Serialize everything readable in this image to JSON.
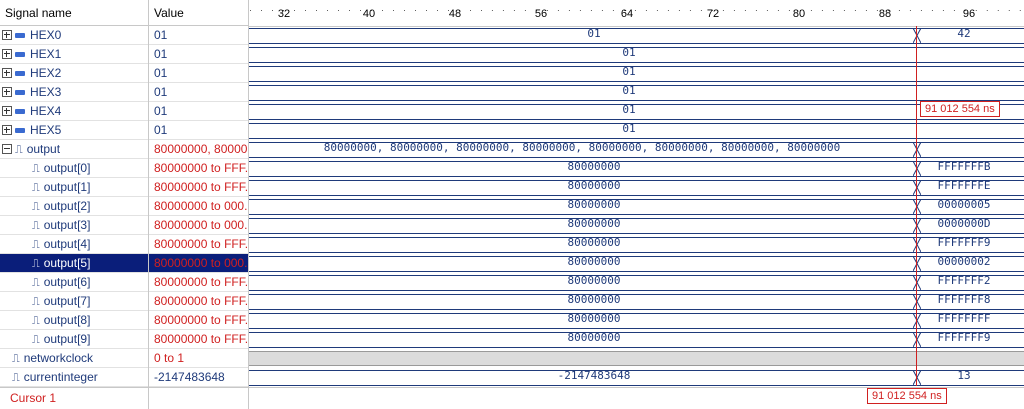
{
  "headers": {
    "signal_name": "Signal name",
    "value": "Value"
  },
  "ruler": {
    "ticks": [
      "32",
      "40",
      "48",
      "56",
      "64",
      "72",
      "80",
      "88",
      "96"
    ]
  },
  "signals": [
    {
      "name": "HEX0",
      "value": "01",
      "type": "bus",
      "expand": "plus",
      "wave_left": "01",
      "wave_right": "42"
    },
    {
      "name": "HEX1",
      "value": "01",
      "type": "bus",
      "expand": "plus",
      "wave_full": "01"
    },
    {
      "name": "HEX2",
      "value": "01",
      "type": "bus",
      "expand": "plus",
      "wave_full": "01"
    },
    {
      "name": "HEX3",
      "value": "01",
      "type": "bus",
      "expand": "plus",
      "wave_full": "01"
    },
    {
      "name": "HEX4",
      "value": "01",
      "type": "bus",
      "expand": "plus",
      "wave_full": "01"
    },
    {
      "name": "HEX5",
      "value": "01",
      "type": "bus",
      "expand": "plus",
      "wave_full": "01"
    },
    {
      "name": "output",
      "value": "80000000, 80000...",
      "type": "array",
      "expand": "minus",
      "wave_left": "80000000, 80000000, 80000000, 80000000, 80000000, 80000000, 80000000, 80000000",
      "wave_right": ""
    },
    {
      "name": "output[0]",
      "value": "80000000 to FFF...",
      "type": "child",
      "wave_left": "80000000",
      "wave_right": "FFFFFFFB"
    },
    {
      "name": "output[1]",
      "value": "80000000 to FFF...",
      "type": "child",
      "wave_left": "80000000",
      "wave_right": "FFFFFFFE"
    },
    {
      "name": "output[2]",
      "value": "80000000 to 000...",
      "type": "child",
      "wave_left": "80000000",
      "wave_right": "00000005"
    },
    {
      "name": "output[3]",
      "value": "80000000 to 000...",
      "type": "child",
      "wave_left": "80000000",
      "wave_right": "0000000D"
    },
    {
      "name": "output[4]",
      "value": "80000000 to FFF...",
      "type": "child",
      "wave_left": "80000000",
      "wave_right": "FFFFFFF9"
    },
    {
      "name": "output[5]",
      "value": "80000000 to 000...",
      "type": "child",
      "selected": true,
      "wave_left": "80000000",
      "wave_right": "00000002"
    },
    {
      "name": "output[6]",
      "value": "80000000 to FFF...",
      "type": "child",
      "wave_left": "80000000",
      "wave_right": "FFFFFFF2"
    },
    {
      "name": "output[7]",
      "value": "80000000 to FFF...",
      "type": "child",
      "wave_left": "80000000",
      "wave_right": "FFFFFFF8"
    },
    {
      "name": "output[8]",
      "value": "80000000 to FFF...",
      "type": "child",
      "wave_left": "80000000",
      "wave_right": "FFFFFFFF"
    },
    {
      "name": "output[9]",
      "value": "80000000 to FFF...",
      "type": "child",
      "wave_left": "80000000",
      "wave_right": "FFFFFFF9"
    },
    {
      "name": "networkclock",
      "value": "0 to 1",
      "type": "clock"
    },
    {
      "name": "currentinteger",
      "value": "-2147483648",
      "type": "int",
      "wave_left": "-2147483648",
      "wave_right": "13"
    }
  ],
  "cursor": {
    "label": "Cursor 1",
    "time": "91 012 554 ns",
    "color": "#d02020"
  },
  "colors": {
    "selection": "#0a1e7a",
    "wave": "#1f3a7a",
    "cursor": "#d02020"
  }
}
